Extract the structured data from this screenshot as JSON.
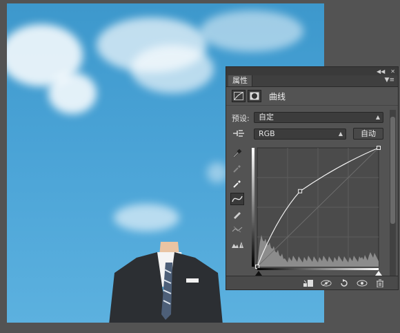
{
  "panel": {
    "tab_label": "属性",
    "title": "曲线",
    "preset_label": "预设:",
    "preset_value": "自定",
    "channel_value": "RGB",
    "auto_button": "自动"
  },
  "colors": {
    "panel_bg": "#535353",
    "field_bg": "#3c3c3c",
    "sky": "#4aa3d6"
  },
  "icons": [
    "panel-collapse-icon",
    "panel-close-icon",
    "panel-menu-icon",
    "curves-adjustment-icon",
    "layer-mask-icon",
    "on-image-adjust-icon",
    "sample-black-eyedropper-icon",
    "sample-gray-eyedropper-icon",
    "sample-white-eyedropper-icon",
    "curve-point-tool-icon",
    "pencil-draw-icon",
    "smooth-curve-icon",
    "clipping-warning-icon",
    "clip-to-layer-icon",
    "view-previous-state-icon",
    "reset-icon",
    "visibility-eye-icon",
    "delete-icon"
  ],
  "curve": {
    "points": [
      [
        0,
        0
      ],
      [
        90,
        162
      ],
      [
        255,
        255
      ]
    ]
  }
}
